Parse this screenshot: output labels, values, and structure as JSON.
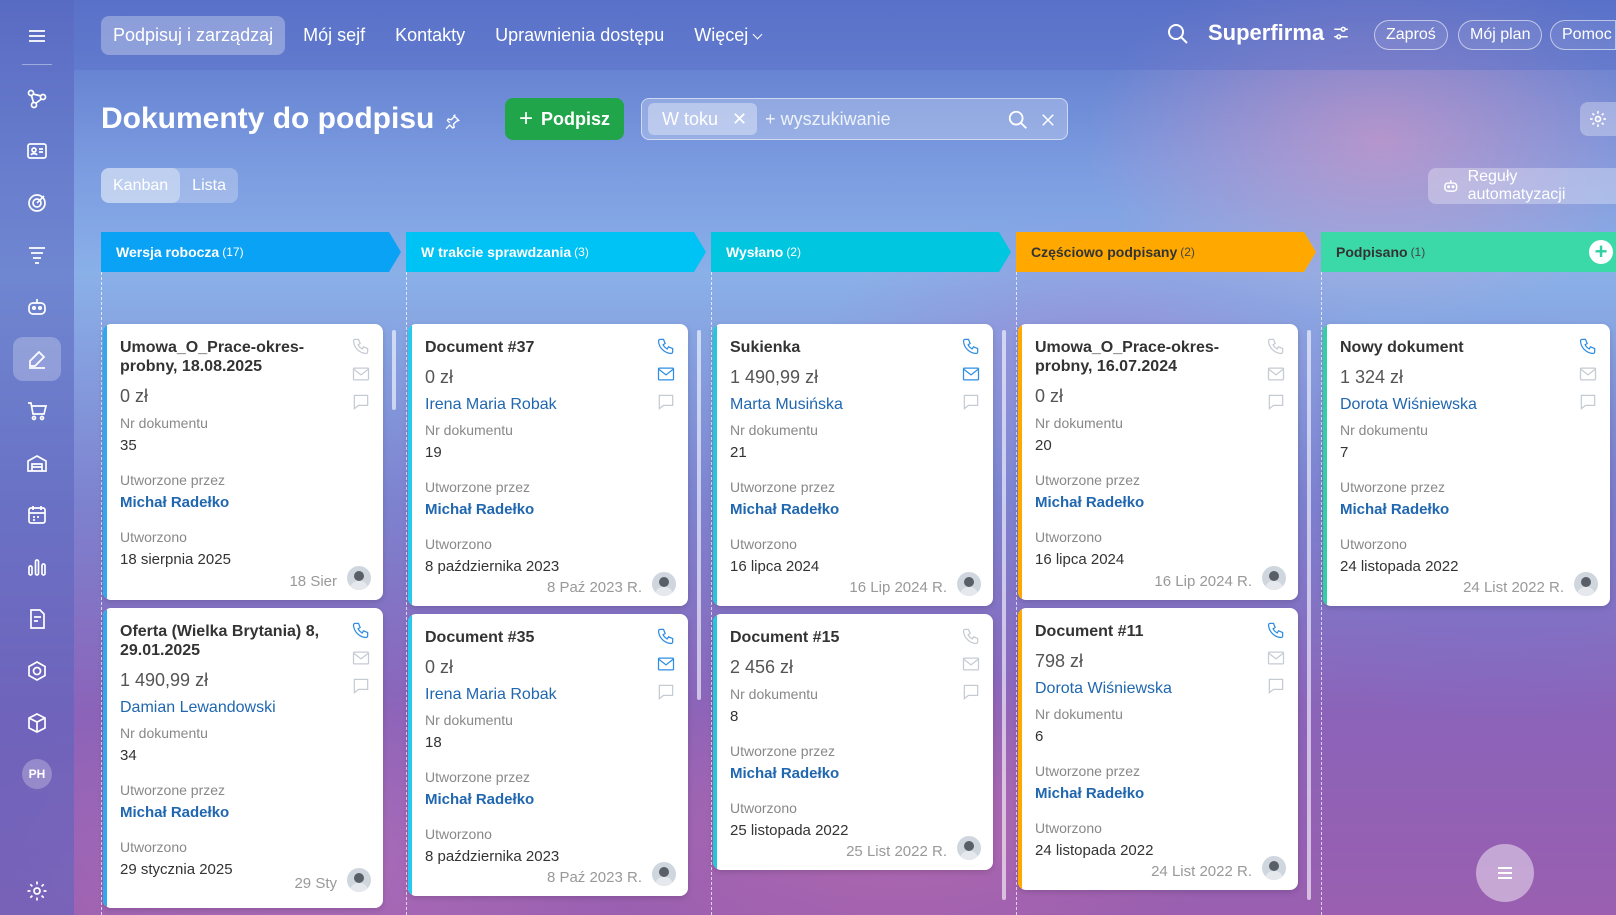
{
  "nav": {
    "items": [
      "Podpisuj i zarządzaj",
      "Mój sejf",
      "Kontakty",
      "Uprawnienia dostępu",
      "Więcej"
    ],
    "brand": "Superfirma",
    "invite": "Zaproś",
    "plan": "Mój plan",
    "help": "Pomoc"
  },
  "sidebar": {
    "avatar": "PH"
  },
  "page": {
    "title": "Dokumenty do podpisu",
    "sign_button": "Podpisz",
    "filter_chip": "W toku",
    "search_placeholder": "+ wyszukiwanie",
    "view_kanban": "Kanban",
    "view_list": "Lista",
    "automation": "Reguły automatyzacji"
  },
  "colors": {
    "blue": "#0aa2f5",
    "cyan": "#00c3f5",
    "teal": "#00c6e0",
    "orange": "#ffa900",
    "green": "#3bd9a8"
  },
  "labels": {
    "doc_no": "Nr dokumentu",
    "created_by": "Utworzone przez",
    "created": "Utworzono"
  },
  "columns": [
    {
      "title": "Wersja robocza",
      "count": "(17)",
      "cards": [
        {
          "title": "Umowa_O_Prace-okres-probny, 18.08.2025",
          "sum": "0 zł",
          "contact": "",
          "doc_no": "35",
          "author": "Michał Radełko",
          "created": "18 sierpnia 2025",
          "date": "18 Sier"
        },
        {
          "title": "Oferta (Wielka Brytania) 8, 29.01.2025",
          "sum": "1 490,99 zł",
          "contact": "Damian Lewandowski",
          "doc_no": "34",
          "author": "Michał Radełko",
          "created": "29 stycznia 2025",
          "date": "29 Sty"
        }
      ]
    },
    {
      "title": "W trakcie sprawdzania",
      "count": "(3)",
      "cards": [
        {
          "title": "Document #37",
          "sum": "0 zł",
          "contact": "Irena Maria Robak",
          "doc_no": "19",
          "author": "Michał Radełko",
          "created": "8 października 2023",
          "date": "8 Paź 2023 R."
        },
        {
          "title": "Document #35",
          "sum": "0 zł",
          "contact": "Irena Maria Robak",
          "doc_no": "18",
          "author": "Michał Radełko",
          "created": "8 października 2023",
          "date": "8 Paź 2023 R."
        }
      ]
    },
    {
      "title": "Wysłano",
      "count": "(2)",
      "cards": [
        {
          "title": "Sukienka",
          "sum": "1 490,99 zł",
          "contact": "Marta Musińska",
          "doc_no": "21",
          "author": "Michał Radełko",
          "created": "16 lipca 2024",
          "date": "16 Lip 2024 R."
        },
        {
          "title": "Document #15",
          "sum": "2 456 zł",
          "contact": "",
          "doc_no": "8",
          "author": "Michał Radełko",
          "created": "25 listopada 2022",
          "date": "25 List 2022 R."
        }
      ]
    },
    {
      "title": "Częściowo podpisany",
      "count": "(2)",
      "cards": [
        {
          "title": "Umowa_O_Prace-okres-probny, 16.07.2024",
          "sum": "0 zł",
          "contact": "",
          "doc_no": "20",
          "author": "Michał Radełko",
          "created": "16 lipca 2024",
          "date": "16 Lip 2024 R."
        },
        {
          "title": "Document #11",
          "sum": "798 zł",
          "contact": "Dorota Wiśniewska",
          "doc_no": "6",
          "author": "Michał Radełko",
          "created": "24 listopada 2022",
          "date": "24 List 2022 R."
        }
      ]
    },
    {
      "title": "Podpisano",
      "count": "(1)",
      "cards": [
        {
          "title": "Nowy dokument",
          "sum": "1 324 zł",
          "contact": "Dorota Wiśniewska",
          "doc_no": "7",
          "author": "Michał Radełko",
          "created": "24 listopada 2022",
          "date": "24 List 2022 R."
        }
      ]
    }
  ]
}
